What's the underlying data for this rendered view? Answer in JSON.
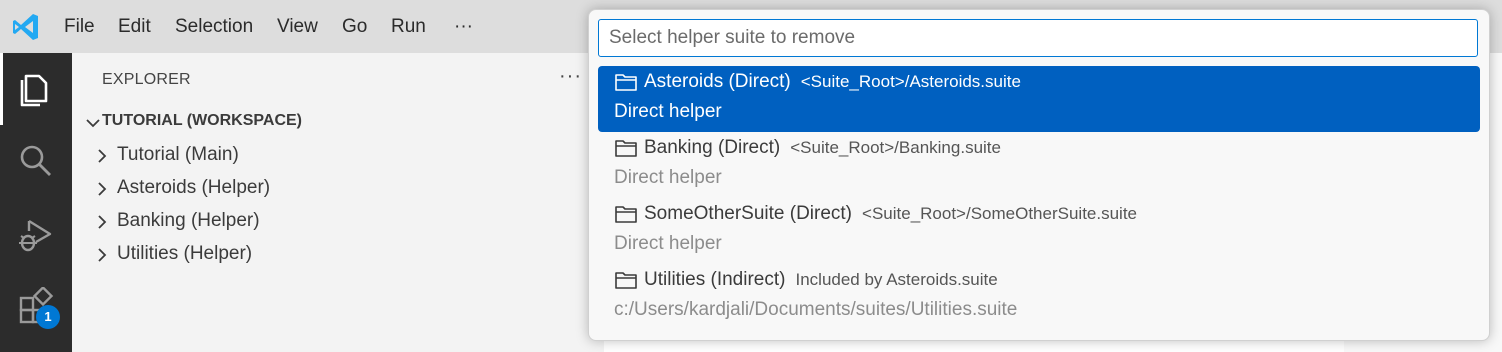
{
  "menu": {
    "items": [
      "File",
      "Edit",
      "Selection",
      "View",
      "Go",
      "Run"
    ],
    "more": "···"
  },
  "activity_bar": {
    "items": [
      "explorer-icon",
      "search-icon",
      "run-debug-icon",
      "extensions-icon"
    ],
    "extensions_badge": "1"
  },
  "sidebar": {
    "title": "EXPLORER",
    "more": "···",
    "workspace_label": "TUTORIAL (WORKSPACE)",
    "folders": [
      "Tutorial (Main)",
      "Asteroids (Helper)",
      "Banking (Helper)",
      "Utilities (Helper)"
    ]
  },
  "quick_pick": {
    "placeholder": "Select helper suite to remove",
    "value": "",
    "items": [
      {
        "label": "Asteroids (Direct)",
        "description": "<Suite_Root>/Asteroids.suite",
        "detail": "Direct helper",
        "selected": true
      },
      {
        "label": "Banking (Direct)",
        "description": "<Suite_Root>/Banking.suite",
        "detail": "Direct helper",
        "selected": false
      },
      {
        "label": "SomeOtherSuite (Direct)",
        "description": "<Suite_Root>/SomeOtherSuite.suite",
        "detail": "Direct helper",
        "selected": false
      },
      {
        "label": "Utilities (Indirect)",
        "description": "Included by Asteroids.suite",
        "detail": "c:/Users/kardjali/Documents/suites/Utilities.suite",
        "selected": false
      }
    ]
  },
  "colors": {
    "accent": "#0078d4",
    "selection": "#0060c0",
    "activity_bar": "#2c2c2c",
    "logo": "#23a9f2"
  }
}
